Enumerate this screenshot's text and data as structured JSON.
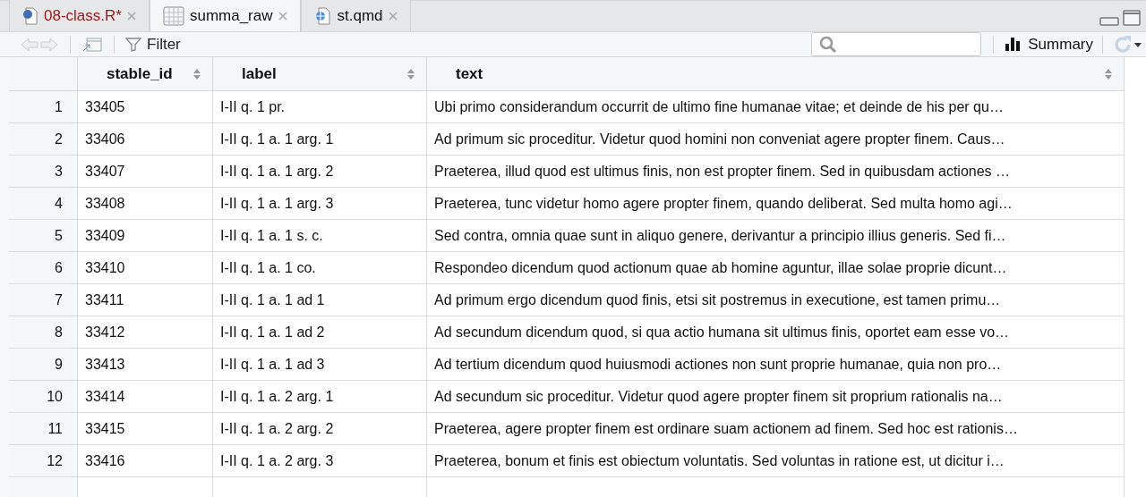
{
  "tabs": [
    {
      "label": "08-class.R*",
      "kind": "r-script",
      "modified": true,
      "selected": false
    },
    {
      "label": "summa_raw",
      "kind": "data",
      "modified": false,
      "selected": true
    },
    {
      "label": "st.qmd",
      "kind": "quarto",
      "modified": false,
      "selected": false
    }
  ],
  "toolbar": {
    "filter": "Filter",
    "summary": "Summary"
  },
  "table": {
    "columns": [
      "",
      "stable_id",
      "label",
      "text"
    ],
    "rows": [
      [
        "1",
        "33405",
        "I-II q. 1 pr.",
        "Ubi primo considerandum occurrit de ultimo fine humanae vitae; et deinde de his per qu…"
      ],
      [
        "2",
        "33406",
        "I-II q. 1 a. 1 arg. 1",
        "Ad primum sic proceditur. Videtur quod homini non conveniat agere propter finem. Caus…"
      ],
      [
        "3",
        "33407",
        "I-II q. 1 a. 1 arg. 2",
        "Praeterea, illud quod est ultimus finis, non est propter finem. Sed in quibusdam actiones …"
      ],
      [
        "4",
        "33408",
        "I-II q. 1 a. 1 arg. 3",
        "Praeterea, tunc videtur homo agere propter finem, quando deliberat. Sed multa homo agi…"
      ],
      [
        "5",
        "33409",
        "I-II q. 1 a. 1 s. c.",
        "Sed contra, omnia quae sunt in aliquo genere, derivantur a principio illius generis. Sed fi…"
      ],
      [
        "6",
        "33410",
        "I-II q. 1 a. 1 co.",
        "Respondeo dicendum quod actionum quae ab homine aguntur, illae solae proprie dicunt…"
      ],
      [
        "7",
        "33411",
        "I-II q. 1 a. 1 ad 1",
        "Ad primum ergo dicendum quod finis, etsi sit postremus in executione, est tamen primu…"
      ],
      [
        "8",
        "33412",
        "I-II q. 1 a. 1 ad 2",
        "Ad secundum dicendum quod, si qua actio humana sit ultimus finis, oportet eam esse vo…"
      ],
      [
        "9",
        "33413",
        "I-II q. 1 a. 1 ad 3",
        "Ad tertium dicendum quod huiusmodi actiones non sunt proprie humanae, quia non pro…"
      ],
      [
        "10",
        "33414",
        "I-II q. 1 a. 2 arg. 1",
        "Ad secundum sic proceditur. Videtur quod agere propter finem sit proprium rationalis na…"
      ],
      [
        "11",
        "33415",
        "I-II q. 1 a. 2 arg. 2",
        "Praeterea, agere propter finem est ordinare suam actionem ad finem. Sed hoc est rationis…"
      ],
      [
        "12",
        "33416",
        "I-II q. 1 a. 2 arg. 3",
        "Praeterea, bonum et finis est obiectum voluntatis. Sed voluntas in ratione est, ut dicitur i…"
      ]
    ]
  }
}
